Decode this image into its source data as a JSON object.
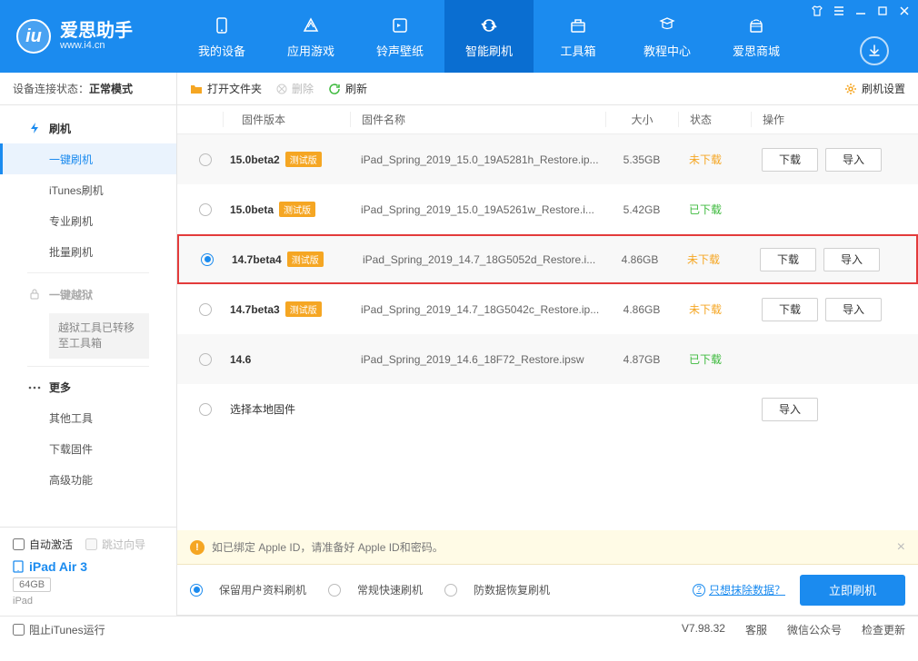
{
  "brand": {
    "title": "爱思助手",
    "url": "www.i4.cn"
  },
  "nav": [
    {
      "label": "我的设备"
    },
    {
      "label": "应用游戏"
    },
    {
      "label": "铃声壁纸"
    },
    {
      "label": "智能刷机"
    },
    {
      "label": "工具箱"
    },
    {
      "label": "教程中心"
    },
    {
      "label": "爱思商城"
    }
  ],
  "sidebar": {
    "status_label": "设备连接状态：",
    "status_value": "正常模式",
    "groups": {
      "flash": "刷机",
      "jailbreak": "一键越狱",
      "more": "更多"
    },
    "flash_items": [
      "一键刷机",
      "iTunes刷机",
      "专业刷机",
      "批量刷机"
    ],
    "jailbreak_note": "越狱工具已转移至工具箱",
    "more_items": [
      "其他工具",
      "下载固件",
      "高级功能"
    ],
    "auto_activate": "自动激活",
    "skip_guide": "跳过向导",
    "device_name": "iPad Air 3",
    "device_cap": "64GB",
    "device_type": "iPad"
  },
  "toolbar": {
    "open_folder": "打开文件夹",
    "delete": "删除",
    "refresh": "刷新",
    "settings": "刷机设置"
  },
  "table_head": {
    "version": "固件版本",
    "name": "固件名称",
    "size": "大小",
    "status": "状态",
    "action": "操作"
  },
  "beta_tag": "测试版",
  "status_labels": {
    "not_downloaded": "未下载",
    "downloaded": "已下载"
  },
  "action_labels": {
    "download": "下载",
    "import": "导入"
  },
  "firmwares": [
    {
      "version": "15.0beta2",
      "beta": true,
      "name": "iPad_Spring_2019_15.0_19A5281h_Restore.ip...",
      "size": "5.35GB",
      "status": "not_downloaded",
      "selected": false,
      "show_dl": true
    },
    {
      "version": "15.0beta",
      "beta": true,
      "name": "iPad_Spring_2019_15.0_19A5261w_Restore.i...",
      "size": "5.42GB",
      "status": "downloaded",
      "selected": false,
      "show_dl": false
    },
    {
      "version": "14.7beta4",
      "beta": true,
      "name": "iPad_Spring_2019_14.7_18G5052d_Restore.i...",
      "size": "4.86GB",
      "status": "not_downloaded",
      "selected": true,
      "show_dl": true
    },
    {
      "version": "14.7beta3",
      "beta": true,
      "name": "iPad_Spring_2019_14.7_18G5042c_Restore.ip...",
      "size": "4.86GB",
      "status": "not_downloaded",
      "selected": false,
      "show_dl": true
    },
    {
      "version": "14.6",
      "beta": false,
      "name": "iPad_Spring_2019_14.6_18F72_Restore.ipsw",
      "size": "4.87GB",
      "status": "downloaded",
      "selected": false,
      "show_dl": false
    }
  ],
  "local_fw_label": "选择本地固件",
  "notice": "如已绑定 Apple ID，请准备好 Apple ID和密码。",
  "options": {
    "keep_data": "保留用户资料刷机",
    "normal": "常规快速刷机",
    "dfu": "防数据恢复刷机",
    "erase_link": "只想抹除数据？",
    "flash_btn": "立即刷机"
  },
  "statusbar": {
    "block_itunes": "阻止iTunes运行",
    "version": "V7.98.32",
    "support": "客服",
    "wechat": "微信公众号",
    "update": "检查更新"
  }
}
